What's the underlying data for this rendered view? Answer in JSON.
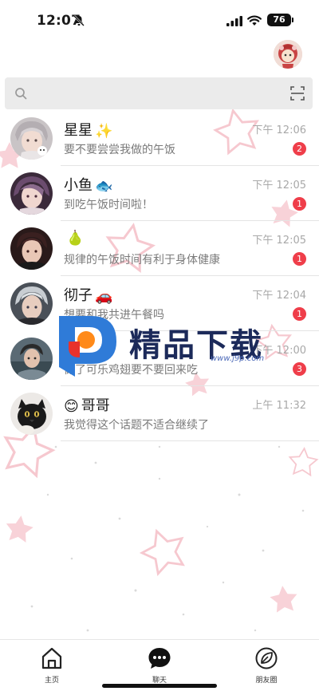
{
  "status": {
    "time": "12:07",
    "battery": "76"
  },
  "search": {
    "placeholder": ""
  },
  "chats": [
    {
      "name": "星星",
      "emoji": "✨",
      "time": "下午 12:06",
      "message": "要不要尝尝我做的午饭",
      "unread": "2"
    },
    {
      "name": "小鱼",
      "emoji": "🐟",
      "time": "下午 12:05",
      "message": "到吃午饭时间啦！",
      "unread": "1"
    },
    {
      "name": "",
      "emoji": "🍐",
      "time": "下午 12:05",
      "message": "规律的午饭时间有利于身体健康",
      "unread": "1"
    },
    {
      "name": "彻子",
      "emoji": "🚗",
      "time": "下午 12:04",
      "message": "想要和我共进午餐吗",
      "unread": "1"
    },
    {
      "name": "",
      "emoji": "",
      "time": "下午 12:00",
      "message": "做了可乐鸡翅要不要回来吃",
      "unread": "3"
    },
    {
      "name": "哥哥",
      "emoji": "😊",
      "time": "上午 11:32",
      "message": "我觉得这个话题不适合继续了",
      "unread": ""
    }
  ],
  "watermark": {
    "title": "精品下载",
    "url": "www.j9p.com"
  },
  "tabs": [
    {
      "label": "主页",
      "icon": "home-icon"
    },
    {
      "label": "聊天",
      "icon": "chat-icon"
    },
    {
      "label": "朋友圈",
      "icon": "moments-icon"
    }
  ],
  "colors": {
    "badge": "#ef3e4a",
    "search_bg": "#ebebeb",
    "star": "#f6c8cf"
  }
}
